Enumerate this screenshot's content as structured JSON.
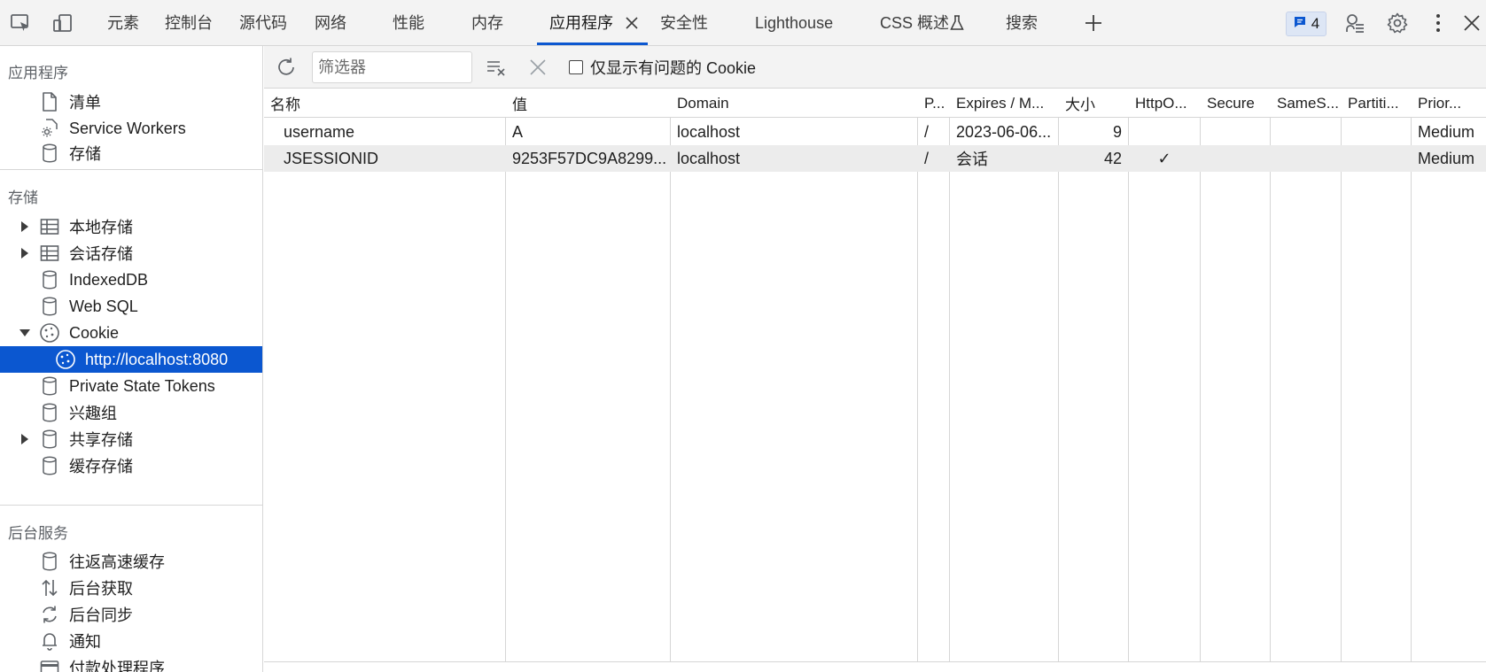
{
  "tabs": [
    {
      "label": "元素"
    },
    {
      "label": "控制台"
    },
    {
      "label": "源代码"
    },
    {
      "label": "网络"
    },
    {
      "label": "性能"
    },
    {
      "label": "内存"
    },
    {
      "label": "应用程序",
      "active": true
    },
    {
      "label": "安全性"
    },
    {
      "label": "Lighthouse"
    },
    {
      "label": "CSS 概述"
    },
    {
      "label": "搜索"
    }
  ],
  "issues_count": "4",
  "accent_color": "#0b57d0",
  "sidebar": {
    "application": {
      "title": "应用程序",
      "items": [
        {
          "label": "清单",
          "icon": "file-icon"
        },
        {
          "label": "Service Workers",
          "icon": "gear-icon"
        },
        {
          "label": "存储",
          "icon": "database-icon"
        }
      ]
    },
    "storage": {
      "title": "存储",
      "items": [
        {
          "label": "本地存储",
          "icon": "table-icon",
          "expandable": true
        },
        {
          "label": "会话存储",
          "icon": "table-icon",
          "expandable": true
        },
        {
          "label": "IndexedDB",
          "icon": "database-icon"
        },
        {
          "label": "Web SQL",
          "icon": "database-icon"
        },
        {
          "label": "Cookie",
          "icon": "cookie-icon",
          "expanded": true
        },
        {
          "label": "http://localhost:8080",
          "icon": "cookie-icon",
          "selected": true
        },
        {
          "label": "Private State Tokens",
          "icon": "database-icon"
        },
        {
          "label": "兴趣组",
          "icon": "database-icon"
        },
        {
          "label": "共享存储",
          "icon": "database-icon",
          "expandable": true
        },
        {
          "label": "缓存存储",
          "icon": "database-icon"
        }
      ]
    },
    "background": {
      "title": "后台服务",
      "items": [
        {
          "label": "往返高速缓存",
          "icon": "database-icon"
        },
        {
          "label": "后台获取",
          "icon": "fetch-arrows-icon"
        },
        {
          "label": "后台同步",
          "icon": "sync-icon"
        },
        {
          "label": "通知",
          "icon": "bell-icon"
        },
        {
          "label": "付款处理程序",
          "icon": "card-icon"
        }
      ]
    }
  },
  "toolbar": {
    "filter_placeholder": "筛选器",
    "only_issues_label": "仅显示有问题的 Cookie",
    "only_issues_checked": false
  },
  "table": {
    "columns": [
      "名称",
      "值",
      "Domain",
      "P...",
      "Expires / M...",
      "大小",
      "HttpO...",
      "Secure",
      "SameS...",
      "Partiti...",
      "Prior..."
    ],
    "rows": [
      {
        "name": "username",
        "value": "A",
        "domain": "localhost",
        "path": "/",
        "expires": "2023-06-06...",
        "size": "9",
        "httponly": "",
        "secure": "",
        "samesite": "",
        "partition": "",
        "priority": "Medium"
      },
      {
        "name": "JSESSIONID",
        "value": "9253F57DC9A8299...",
        "domain": "localhost",
        "path": "/",
        "expires": "会话",
        "size": "42",
        "httponly": "✓",
        "secure": "",
        "samesite": "",
        "partition": "",
        "priority": "Medium"
      }
    ]
  }
}
